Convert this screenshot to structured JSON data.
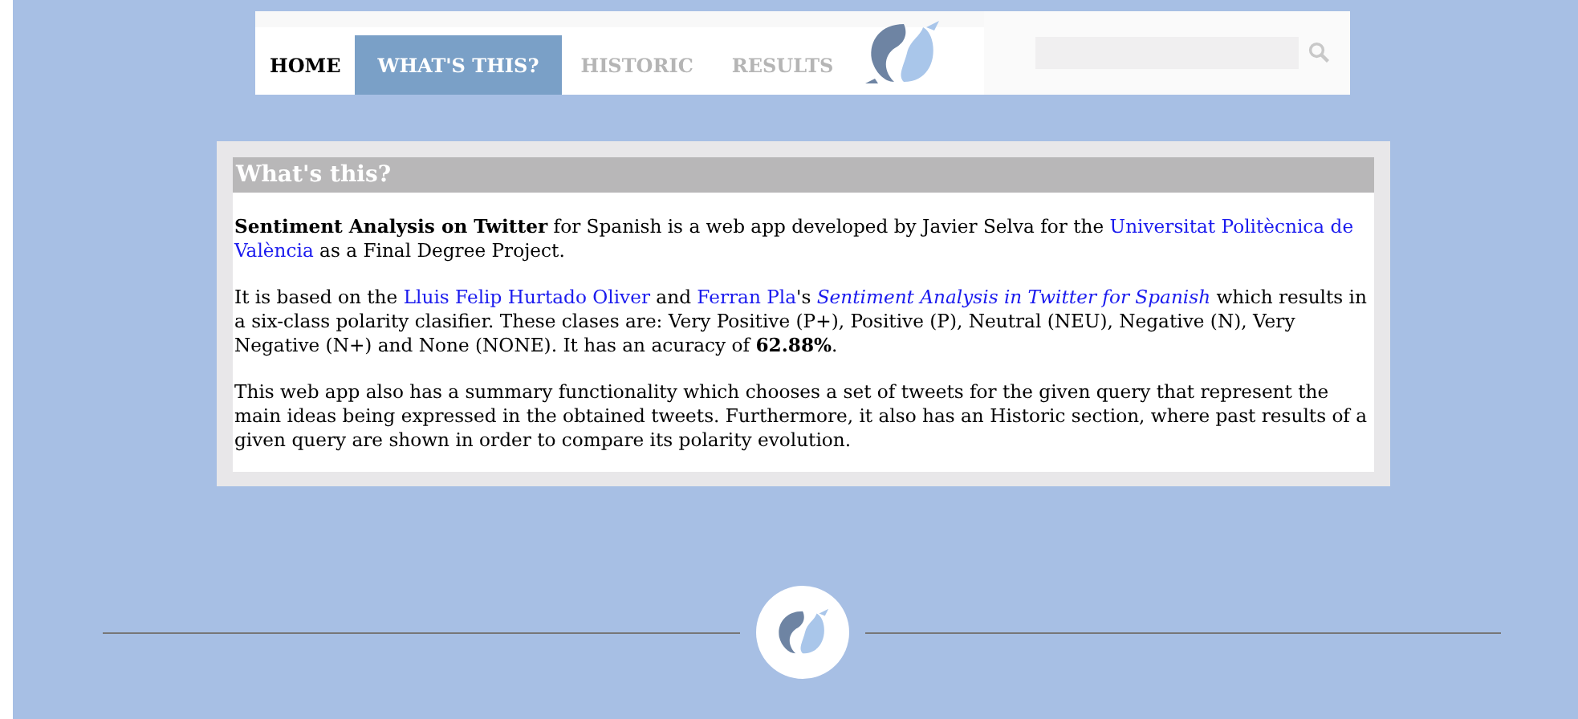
{
  "nav": {
    "tabs": [
      {
        "label": "HOME",
        "selected": false,
        "kind": "current"
      },
      {
        "label": "WHAT'S THIS?",
        "selected": true,
        "kind": "tab"
      },
      {
        "label": "HISTORIC",
        "selected": false,
        "kind": "tab"
      },
      {
        "label": "RESULTS",
        "selected": false,
        "kind": "tab"
      }
    ]
  },
  "section": {
    "title": "What's this?",
    "paragraphs": [
      [
        {
          "kind": "bold",
          "text": "Sentiment Analysis on Twitter"
        },
        {
          "kind": "text",
          "text": " for Spanish is a web app developed by Javier Selva for the "
        },
        {
          "kind": "wrapped-link",
          "lines": [
            "Universitat Politècnica de",
            "València"
          ]
        },
        {
          "kind": "text",
          "text": " as a Final Degree Project."
        }
      ],
      [
        {
          "kind": "text",
          "text": "It is based on the "
        },
        {
          "kind": "link",
          "text": "Lluis Felip Hurtado Oliver"
        },
        {
          "kind": "text",
          "text": " and "
        },
        {
          "kind": "link",
          "text": "Ferran Pla"
        },
        {
          "kind": "text",
          "text": "'s "
        },
        {
          "kind": "italic-link",
          "text": "Sentiment Analysis in Twitter for Spanish"
        },
        {
          "kind": "text",
          "text": " which results in a six-class polarity clasifier. These clases are: Very Positive (P+), Positive (P), Neutral (NEU), Negative (N), Very Negative (N+) and None (NONE). It has an acuracy of "
        },
        {
          "kind": "bold",
          "text": "62.88%"
        },
        {
          "kind": "text",
          "text": "."
        }
      ],
      [
        {
          "kind": "text",
          "text": "This web app also has a summary functionality which chooses a set of tweets for the given query that represent the main ideas being expressed in the obtained tweets. Furthermore, it also has an Historic section, where past results of a given query are shown in order to compare its polarity evolution."
        }
      ]
    ]
  }
}
